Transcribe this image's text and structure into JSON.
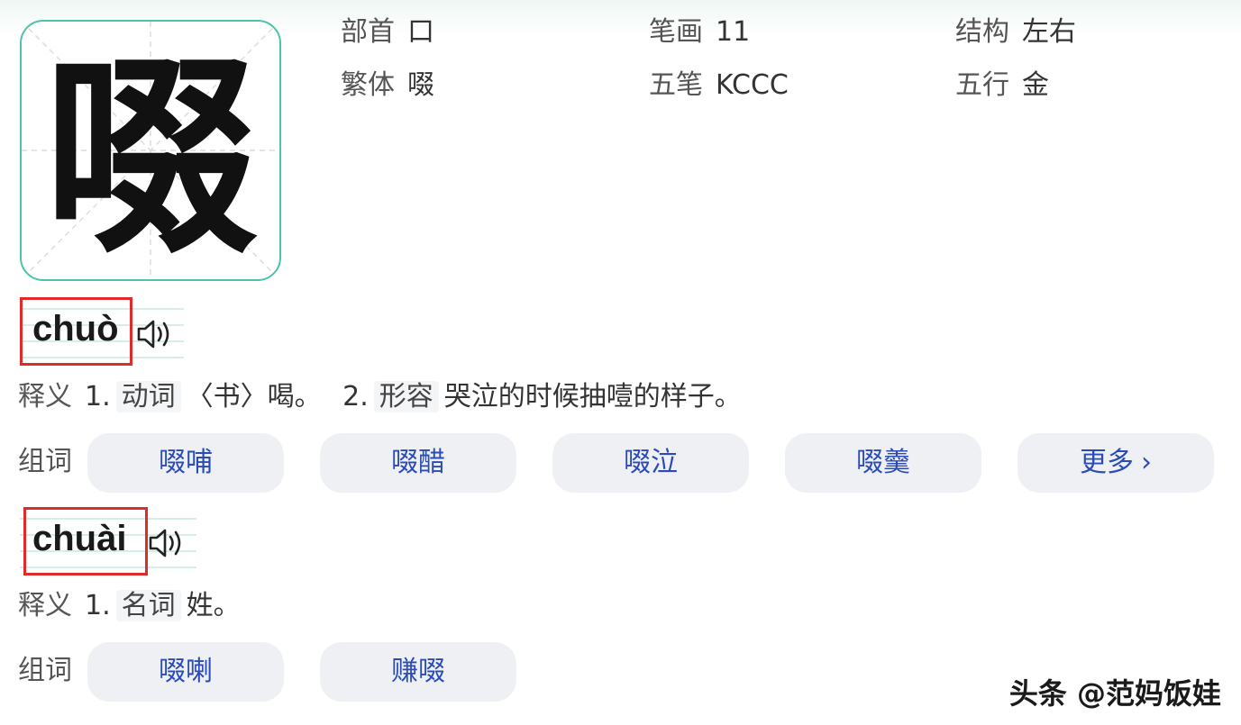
{
  "character": {
    "glyph": "啜"
  },
  "info": {
    "radical_label": "部首",
    "radical_value": "口",
    "strokes_label": "笔画",
    "strokes_value": "11",
    "structure_label": "结构",
    "structure_value": "左右",
    "traditional_label": "繁体",
    "traditional_value": "啜",
    "wubi_label": "五笔",
    "wubi_value": "KCCC",
    "wuxing_label": "五行",
    "wuxing_value": "金"
  },
  "readings": [
    {
      "pinyin": "chuò",
      "def_label": "释义",
      "defs": [
        {
          "num": "1.",
          "pos": "动词",
          "text": "〈书〉喝。"
        },
        {
          "num": "2.",
          "pos": "形容",
          "text": "哭泣的时候抽噎的样子。"
        }
      ],
      "words_label": "组词",
      "words": [
        "啜哺",
        "啜醋",
        "啜泣",
        "啜羹"
      ],
      "more_label": "更多"
    },
    {
      "pinyin": "chuài",
      "def_label": "释义",
      "defs": [
        {
          "num": "1.",
          "pos": "名词",
          "text": "姓。"
        }
      ],
      "words_label": "组词",
      "words": [
        "啜喇",
        "赚啜"
      ]
    }
  ],
  "watermark": "头条 @范妈饭娃",
  "icons": {
    "speaker": "speaker-icon",
    "chevron": "chevron-right-icon"
  },
  "colors": {
    "accent_border": "#4fc2aa",
    "highlight_box": "#e02b2b",
    "link": "#2a4bb8"
  }
}
